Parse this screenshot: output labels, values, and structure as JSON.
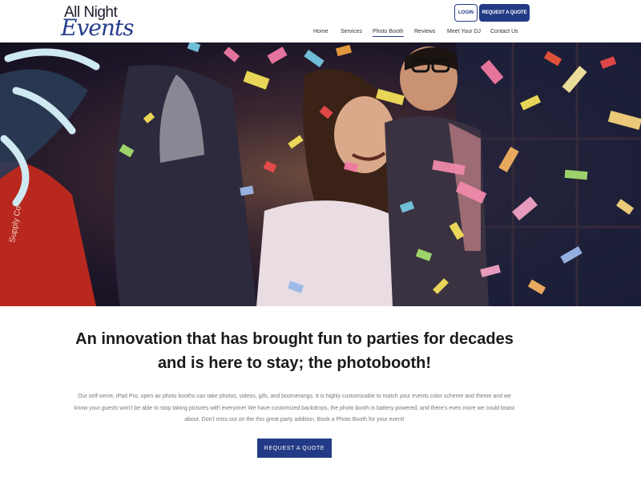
{
  "brand": {
    "line1": "All Night",
    "line2": "Events"
  },
  "header": {
    "login_label": "LOGIN",
    "quote_label": "REQUEST A QUOTE"
  },
  "nav": {
    "items": [
      {
        "label": "Home"
      },
      {
        "label": "Services"
      },
      {
        "label": "Photo Booth",
        "active": true
      },
      {
        "label": "Reviews"
      },
      {
        "label": "Meet Your DJ"
      },
      {
        "label": "Contact Us"
      }
    ]
  },
  "hero": {
    "image_desc": "Party guests laughing under falling confetti at a photo booth",
    "sign_text": "Supply Co"
  },
  "main": {
    "headline": "An innovation that has brought fun to parties for decades and is here to stay; the photobooth!",
    "body": "Our self-serve, iPad Pro, open air photo booths can take photos, videos, gifs, and boomerangs. It is highly customizable to match your events color scheme and theme and we know your guests won't be able to stop taking pictures with everyone! We have customized backdrops, the photo booth is battery powered, and there's even more we could boast about. Don't miss out on the this great party addition. Book a Photo Booth for your event!",
    "cta_label": "REQUEST A QUOTE"
  },
  "colors": {
    "brand_blue": "#233b86",
    "text_gray": "#777777"
  }
}
